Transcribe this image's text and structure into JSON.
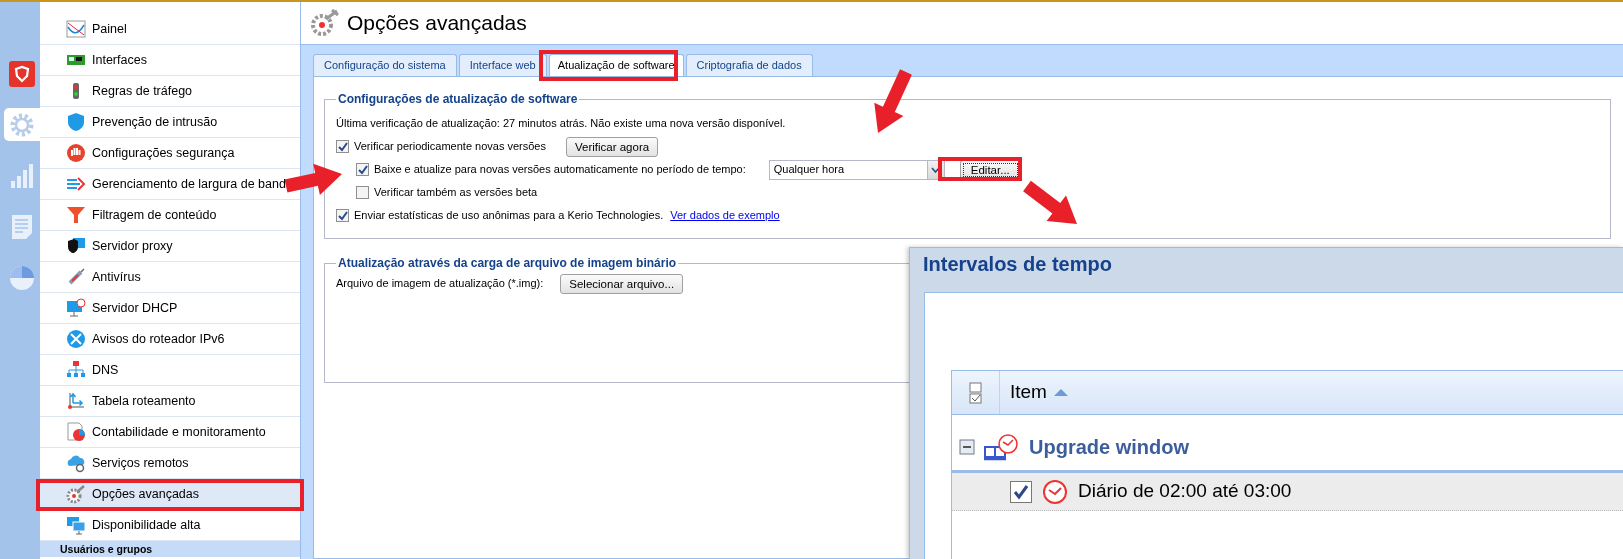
{
  "rail": [
    {
      "kind": "shield",
      "selected": false
    },
    {
      "kind": "gear",
      "selected": true
    },
    {
      "kind": "chart",
      "selected": false
    },
    {
      "kind": "report",
      "selected": false
    },
    {
      "kind": "pie",
      "selected": false
    }
  ],
  "sidebar": {
    "items": [
      {
        "label": "Painel",
        "selected": false
      },
      {
        "label": "Interfaces",
        "selected": false
      },
      {
        "label": "Regras de tráfego",
        "selected": false
      },
      {
        "label": "Prevenção de intrusão",
        "selected": false
      },
      {
        "label": "Configurações segurança",
        "selected": false
      },
      {
        "label": "Gerenciamento de largura de band",
        "selected": false
      },
      {
        "label": "Filtragem de conteúdo",
        "selected": false
      },
      {
        "label": "Servidor proxy",
        "selected": false
      },
      {
        "label": "Antivírus",
        "selected": false
      },
      {
        "label": "Servidor DHCP",
        "selected": false
      },
      {
        "label": "Avisos do roteador IPv6",
        "selected": false
      },
      {
        "label": "DNS",
        "selected": false
      },
      {
        "label": "Tabela roteamento",
        "selected": false
      },
      {
        "label": "Contabilidade e monitoramento",
        "selected": false
      },
      {
        "label": "Serviços remotos",
        "selected": false
      },
      {
        "label": "Opções avançadas",
        "selected": true
      },
      {
        "label": "Disponibilidade alta",
        "selected": false
      }
    ],
    "section": "Usuários e grupos"
  },
  "page_title": "Opções avançadas",
  "tabs": [
    {
      "label": "Configuração do sistema",
      "selected": false
    },
    {
      "label": "Interface web",
      "selected": false
    },
    {
      "label": "Atualização de software",
      "selected": true
    },
    {
      "label": "Criptografia de dados",
      "selected": false
    }
  ],
  "update_settings": {
    "legend": "Configurações de atualização de software",
    "status": "Última verificação de atualização: 27 minutos atrás. Não existe uma nova versão disponível.",
    "options": [
      {
        "label": "Verificar periodicamente novas versões",
        "checked": true,
        "button": "Verificar agora",
        "children": [
          {
            "label": "Baixe e atualize para novas versões automaticamente no período de tempo:",
            "checked": true,
            "dropdown": "Qualquer hora",
            "button": "Editar..."
          },
          {
            "label": "Verificar também as versões beta",
            "checked": false
          }
        ]
      },
      {
        "label": "Enviar estatísticas de uso anônimas para a Kerio Technologies.",
        "checked": true,
        "link": "Ver dados de exemplo"
      }
    ]
  },
  "image_upload": {
    "legend": "Atualização através da carga de arquivo de imagem binário",
    "label": "Arquivo de imagem de atualização (*.img):",
    "button": "Selecionar arquivo..."
  },
  "dialog": {
    "title": "Intervalos de tempo",
    "columns": [
      "Item"
    ],
    "groups": [
      {
        "label": "Upgrade window",
        "expanded": true,
        "items": [
          {
            "label": "Diário de 02:00 até 03:00",
            "checked": true
          }
        ]
      }
    ]
  }
}
